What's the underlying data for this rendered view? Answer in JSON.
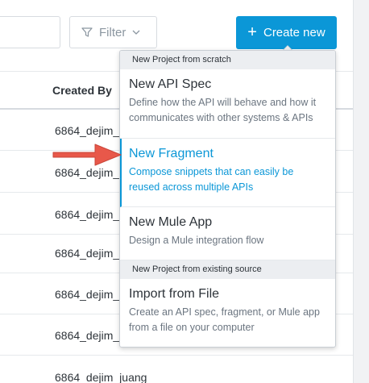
{
  "toolbar": {
    "filter_label": "Filter",
    "create_label": "Create new"
  },
  "table": {
    "column_header": "Created By",
    "rows": [
      "6864_dejim_",
      "6864_dejim_",
      "6864_dejim_",
      "6864_dejim_",
      "6864_dejim_",
      "6864_dejim_",
      "6864_dejim_juang"
    ]
  },
  "menu": {
    "section_scratch": "New Project from scratch",
    "section_existing": "New Project from existing source",
    "items": [
      {
        "title": "New API Spec",
        "desc": "Define how the API will behave and how it communicates with other systems & APIs"
      },
      {
        "title": "New Fragment",
        "desc": "Compose snippets that can easily be reused across multiple APIs"
      },
      {
        "title": "New Mule App",
        "desc": "Design a Mule integration flow"
      },
      {
        "title": "Import from File",
        "desc": "Create an API spec, fragment, or Mule app from a file on your computer"
      }
    ]
  },
  "colors": {
    "accent": "#0b97d7",
    "arrow": "#e8584a"
  },
  "icons": [
    "funnel-icon",
    "chevron-down-icon",
    "plus-icon",
    "arrow-pointer"
  ]
}
